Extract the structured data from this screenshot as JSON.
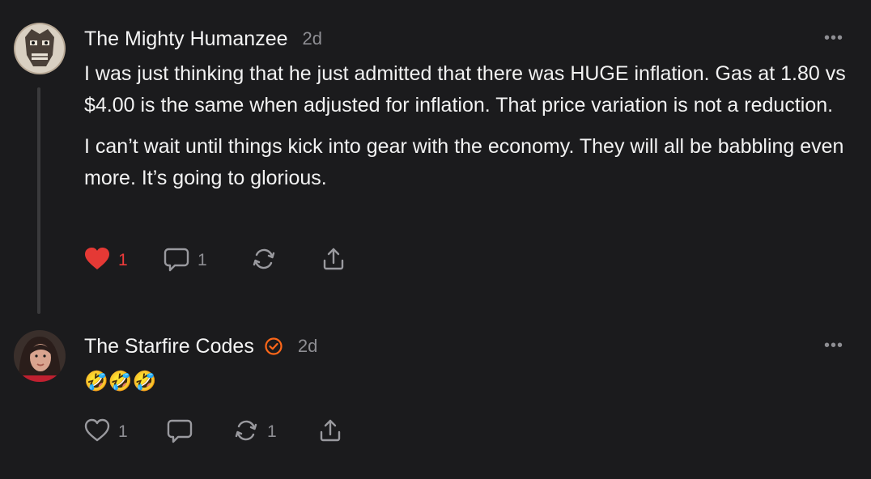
{
  "comments": [
    {
      "author": "The Mighty Humanzee",
      "time": "2d",
      "more": "•••",
      "paragraphs": [
        "I was just thinking that he just admitted that there was HUGE inflation. Gas at 1.80 vs $4.00 is the same when adjusted for inflation. That price variation is not a reduction.",
        "I can’t wait until things kick into gear with the economy. They will all be babbling even more. It’s going to glorious."
      ],
      "like_count": "1",
      "liked": true,
      "reply_count": "1",
      "restack_count": "",
      "icons": [
        "heart-icon",
        "comment-icon",
        "restack-icon",
        "share-icon"
      ],
      "like_color": "#e53935"
    },
    {
      "author": "The Starfire Codes",
      "time": "2d",
      "more": "•••",
      "verified": true,
      "verified_color": "#ff6719",
      "text": "🤣🤣🤣",
      "like_count": "1",
      "reply_count": "",
      "restack_count": "1",
      "icons": [
        "heart-outline-icon",
        "comment-icon",
        "restack-icon",
        "share-icon"
      ]
    }
  ]
}
